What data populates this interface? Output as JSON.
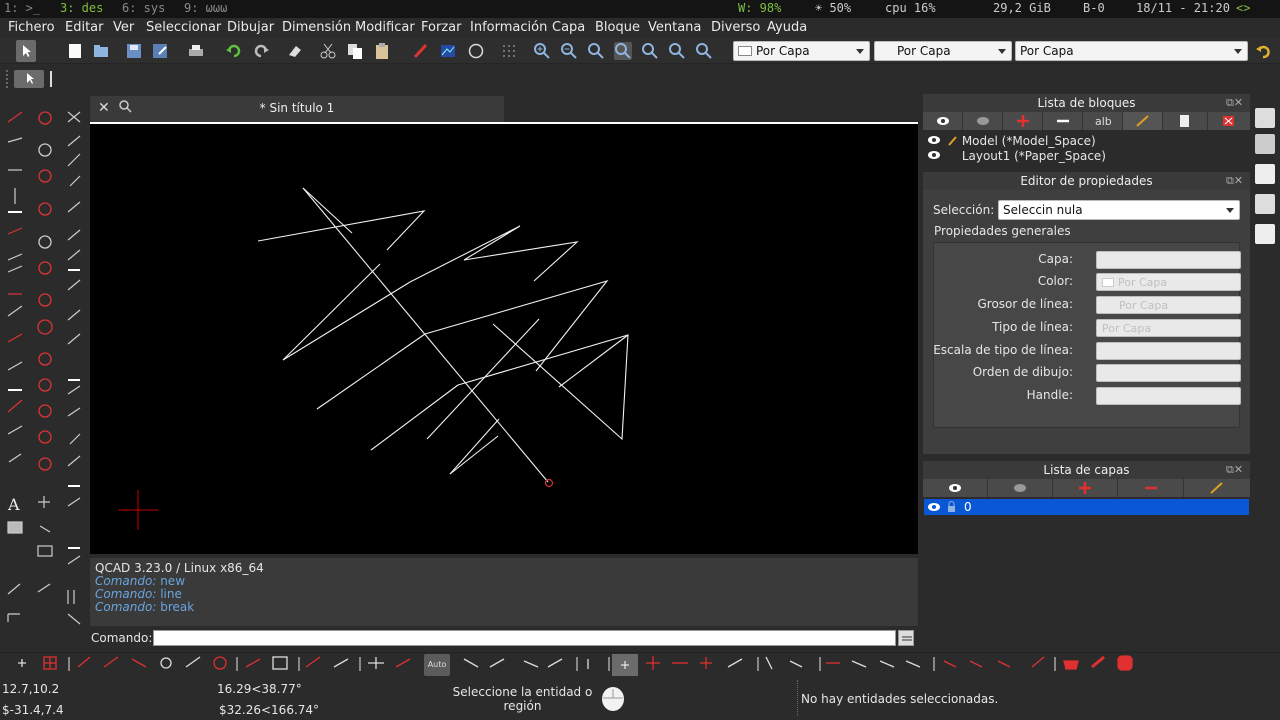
{
  "statusbar": {
    "ws1": "1: >_",
    "ws3": "3: des",
    "ws6": "6: sys",
    "ws9": "9: ωωω",
    "wifi": "W: 98%",
    "brightness": "☀ 50%",
    "cpu": "cpu 16%",
    "disk": "29,2 GiB",
    "battery": "B-0",
    "datetime": "18/11 - 21:20",
    "arrows": "<>"
  },
  "menu": [
    "Fichero",
    "Editar",
    "Ver",
    "Seleccionar",
    "Dibujar",
    "Dimensión",
    "Modificar",
    "Forzar",
    "Información",
    "Capa",
    "Bloque",
    "Ventana",
    "Diverso",
    "Ayuda"
  ],
  "toolbar": {
    "color_combo": "Por Capa",
    "linewidth_combo": "Por Capa",
    "linetype_combo": "Por Capa"
  },
  "document": {
    "title": "* Sin título 1"
  },
  "console": {
    "version": "QCAD 3.23.0 / Linux x86_64",
    "prefix": "Comando:",
    "history": [
      "new",
      "line",
      "break"
    ]
  },
  "command": {
    "label": "Comando:",
    "value": ""
  },
  "blocks": {
    "title": "Lista de bloques",
    "items": [
      "Model (*Model_Space)",
      "Layout1 (*Paper_Space)"
    ]
  },
  "properties": {
    "title": "Editor de propiedades",
    "selection_label": "Selección:",
    "selection_value": "Seleccin nula",
    "group_title": "Propiedades generales",
    "fields": [
      {
        "label": "Capa:",
        "value": ""
      },
      {
        "label": "Color:",
        "value": "Por Capa"
      },
      {
        "label": "Grosor de línea:",
        "value": "Por Capa"
      },
      {
        "label": "Tipo de línea:",
        "value": "Por Capa"
      },
      {
        "label": "Escala de tipo de línea:",
        "value": ""
      },
      {
        "label": "Orden de dibujo:",
        "value": ""
      },
      {
        "label": "Handle:",
        "value": ""
      }
    ]
  },
  "layers": {
    "title": "Lista de capas",
    "items": [
      "0"
    ]
  },
  "snapbar": {
    "auto_label": "Auto"
  },
  "footer": {
    "coord_abs": "12.7,10.2",
    "coord_rel": "$-31.4,7.4",
    "polar_abs": "16.29<38.77°",
    "polar_rel": "$32.26<166.74°",
    "prompt": "Seleccione la entidad o región",
    "selection_status": "No hay entidades seleccionadas."
  },
  "colors": {
    "accent": "#0a57d6",
    "console_cmd": "#6aa4dd",
    "canvas_bg": "#000000",
    "crosshair": "#cc0000",
    "statusbar_green": "#7fbf3f"
  }
}
